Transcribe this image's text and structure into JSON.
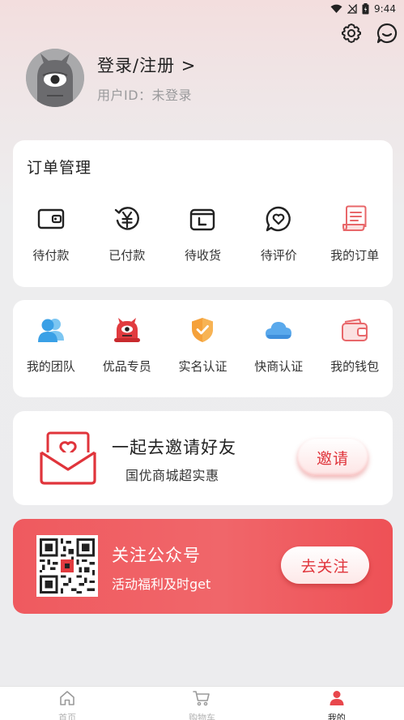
{
  "status_bar": {
    "time": "9:44",
    "icons": [
      "wifi-icon",
      "signal-off-icon",
      "battery-icon"
    ]
  },
  "header": {
    "settings_icon": "gear-icon",
    "message_icon": "chat-bubble-icon"
  },
  "profile": {
    "avatar_icon": "cyclops-monster-avatar",
    "login_label": "登录/注册 >",
    "user_id_label": "用户ID：未登录"
  },
  "orders": {
    "title": "订单管理",
    "items": [
      {
        "label": "待付款",
        "icon": "wallet-outline-icon"
      },
      {
        "label": "已付款",
        "icon": "yuan-refresh-icon"
      },
      {
        "label": "待收货",
        "icon": "box-icon"
      },
      {
        "label": "待评价",
        "icon": "heart-chat-icon"
      },
      {
        "label": "我的订单",
        "icon": "receipt-icon"
      }
    ]
  },
  "services": {
    "items": [
      {
        "label": "我的团队",
        "icon": "team-icon"
      },
      {
        "label": "优品专员",
        "icon": "red-monster-icon"
      },
      {
        "label": "实名认证",
        "icon": "shield-check-icon"
      },
      {
        "label": "快商认证",
        "icon": "cloud-icon"
      },
      {
        "label": "我的钱包",
        "icon": "wallet-icon"
      }
    ]
  },
  "invite": {
    "icon": "envelope-heart-icon",
    "title": "一起去邀请好友",
    "subtitle": "国优商城超实惠",
    "button_label": "邀请"
  },
  "follow": {
    "icon": "qr-code",
    "title": "关注公众号",
    "subtitle": "活动福利及时get",
    "button_label": "去关注"
  },
  "tabbar": {
    "tabs": [
      {
        "label": "首页",
        "icon": "home-icon",
        "active": false
      },
      {
        "label": "购物车",
        "icon": "cart-icon",
        "active": false
      },
      {
        "label": "我的",
        "icon": "person-icon",
        "active": true
      }
    ]
  },
  "colors": {
    "accent": "#e0343b",
    "follow_bg": "#ef5a5f",
    "text_muted": "#9a9a9c"
  }
}
